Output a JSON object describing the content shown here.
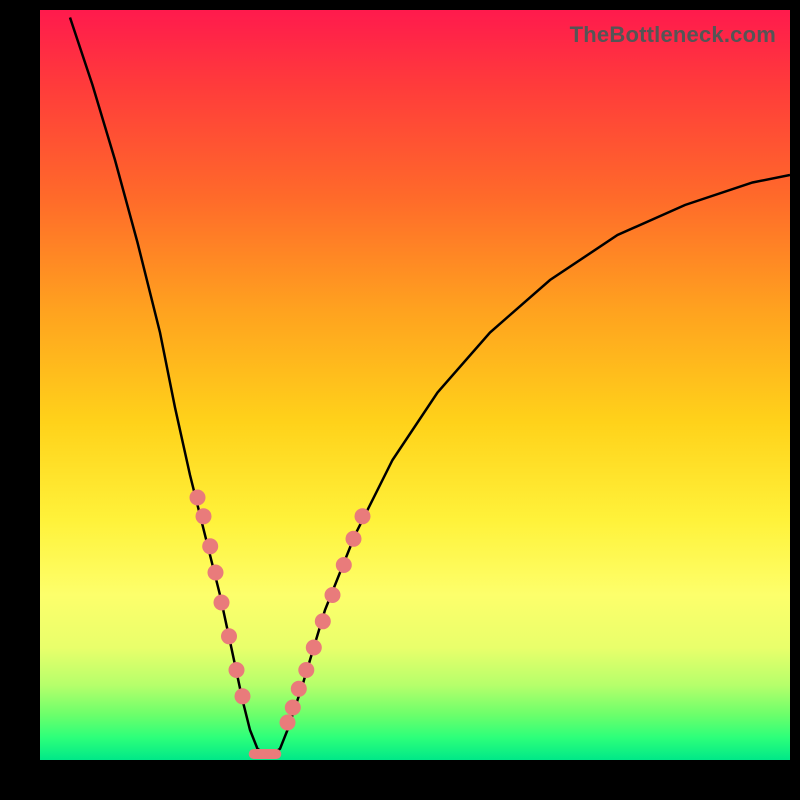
{
  "watermark": "TheBottleneck.com",
  "chart_data": {
    "type": "line",
    "title": "",
    "xlabel": "",
    "ylabel": "",
    "xlim": [
      0,
      100
    ],
    "ylim": [
      0,
      100
    ],
    "grid": false,
    "legend": false,
    "curve_points": [
      {
        "x": 4,
        "y": 99
      },
      {
        "x": 7,
        "y": 90
      },
      {
        "x": 10,
        "y": 80
      },
      {
        "x": 13,
        "y": 69
      },
      {
        "x": 16,
        "y": 57
      },
      {
        "x": 18,
        "y": 47
      },
      {
        "x": 20,
        "y": 38
      },
      {
        "x": 22,
        "y": 30
      },
      {
        "x": 24,
        "y": 22
      },
      {
        "x": 25.5,
        "y": 15
      },
      {
        "x": 27,
        "y": 8
      },
      {
        "x": 28,
        "y": 4
      },
      {
        "x": 29,
        "y": 1.5
      },
      {
        "x": 30,
        "y": 0.8
      },
      {
        "x": 31,
        "y": 0.8
      },
      {
        "x": 32,
        "y": 1.5
      },
      {
        "x": 33,
        "y": 4
      },
      {
        "x": 35,
        "y": 10
      },
      {
        "x": 38,
        "y": 20
      },
      {
        "x": 42,
        "y": 30
      },
      {
        "x": 47,
        "y": 40
      },
      {
        "x": 53,
        "y": 49
      },
      {
        "x": 60,
        "y": 57
      },
      {
        "x": 68,
        "y": 64
      },
      {
        "x": 77,
        "y": 70
      },
      {
        "x": 86,
        "y": 74
      },
      {
        "x": 95,
        "y": 77
      },
      {
        "x": 100,
        "y": 78
      }
    ],
    "markers_left": [
      {
        "x": 21.0,
        "y": 35.0
      },
      {
        "x": 21.8,
        "y": 32.5
      },
      {
        "x": 22.7,
        "y": 28.5
      },
      {
        "x": 23.4,
        "y": 25.0
      },
      {
        "x": 24.2,
        "y": 21.0
      },
      {
        "x": 25.2,
        "y": 16.5
      },
      {
        "x": 26.2,
        "y": 12.0
      },
      {
        "x": 27.0,
        "y": 8.5
      }
    ],
    "markers_right": [
      {
        "x": 33.0,
        "y": 5.0
      },
      {
        "x": 33.7,
        "y": 7.0
      },
      {
        "x": 34.5,
        "y": 9.5
      },
      {
        "x": 35.5,
        "y": 12.0
      },
      {
        "x": 36.5,
        "y": 15.0
      },
      {
        "x": 37.7,
        "y": 18.5
      },
      {
        "x": 39.0,
        "y": 22.0
      },
      {
        "x": 40.5,
        "y": 26.0
      },
      {
        "x": 41.8,
        "y": 29.5
      },
      {
        "x": 43.0,
        "y": 32.5
      }
    ],
    "bottom_segment": {
      "x0": 28.5,
      "x1": 31.5,
      "y": 0.8
    },
    "marker_color": "#e97b7b",
    "marker_radius_px": 8
  }
}
